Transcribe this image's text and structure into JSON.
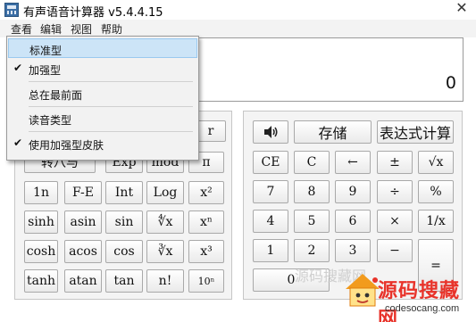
{
  "window": {
    "title": "有声语音计算器 v5.4.4.15",
    "close_symbol": "✕"
  },
  "menu": {
    "items": [
      "查看",
      "编辑",
      "视图",
      "帮助"
    ]
  },
  "dropdown": {
    "items": [
      {
        "label": "标准型",
        "checked": false,
        "highlighted": true
      },
      {
        "label": "加强型",
        "checked": true,
        "highlighted": false
      },
      {
        "label": "总在最前面",
        "checked": false,
        "highlighted": false
      },
      {
        "label": "读音类型",
        "checked": false,
        "highlighted": false
      },
      {
        "label": "使用加强型皮肤",
        "checked": true,
        "highlighted": false
      }
    ],
    "check_symbol": "✔"
  },
  "display": {
    "value": "0"
  },
  "left_buttons": [
    [
      "转八与",
      "Exp",
      "mod",
      "π"
    ],
    [
      "1n",
      "F-E",
      "Int",
      "Log",
      "x²"
    ],
    [
      "sinh",
      "asin",
      "sin",
      "∜x",
      "xⁿ"
    ],
    [
      "cosh",
      "acos",
      "cos",
      "∛x",
      "x³"
    ],
    [
      "tanh",
      "atan",
      "tan",
      "n!",
      "10ⁿ"
    ]
  ],
  "left_partial_label": "r",
  "right_buttons": {
    "top": {
      "speaker": "🔊",
      "store": "存储",
      "expr": "表达式计算"
    },
    "rows": [
      [
        "CE",
        "C",
        "←",
        "±",
        "√x"
      ],
      [
        "7",
        "8",
        "9",
        "÷",
        "%"
      ],
      [
        "4",
        "5",
        "6",
        "×",
        "1/x"
      ],
      [
        "1",
        "2",
        "3",
        "−",
        "="
      ],
      [
        "0"
      ]
    ]
  },
  "watermark": {
    "title": "源码搜藏网",
    "url": "codesocang.com",
    "faded": "源码搜藏网"
  }
}
